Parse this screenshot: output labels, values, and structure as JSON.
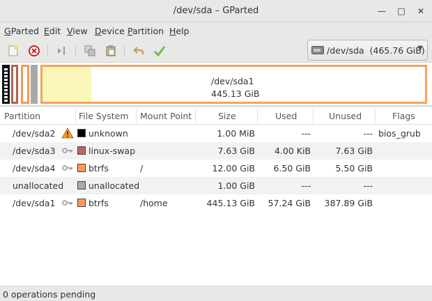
{
  "window": {
    "title": "/dev/sda – GParted"
  },
  "menu": [
    {
      "pre": "",
      "key": "G",
      "post": "Parted"
    },
    {
      "pre": "",
      "key": "E",
      "post": "dit"
    },
    {
      "pre": "",
      "key": "V",
      "post": "iew"
    },
    {
      "pre": "",
      "key": "D",
      "post": "evice"
    },
    {
      "pre": "",
      "key": "P",
      "post": "artition"
    },
    {
      "pre": "",
      "key": "H",
      "post": "elp"
    }
  ],
  "device": {
    "name": "/dev/sda",
    "size": "(465.76 GiB)"
  },
  "diskmap": {
    "main_name": "/dev/sda1",
    "main_size": "445.13 GiB"
  },
  "columns": [
    "Partition",
    "File System",
    "Mount Point",
    "Size",
    "Used",
    "Unused",
    "Flags"
  ],
  "rows": [
    {
      "partition": "/dev/sda2",
      "icon": "warning-icon",
      "fs": "unknown",
      "fs_color": "#000000",
      "mount": "",
      "size": "1.00 MiB",
      "used": "---",
      "unused": "---",
      "flags": "bios_grub"
    },
    {
      "partition": "/dev/sda3",
      "icon": "key-icon",
      "fs": "linux-swap",
      "fs_color": "#c1665a",
      "mount": "",
      "size": "7.63 GiB",
      "used": "4.00 KiB",
      "unused": "7.63 GiB",
      "flags": ""
    },
    {
      "partition": "/dev/sda4",
      "icon": "key-icon",
      "fs": "btrfs",
      "fs_color": "#ff9955",
      "mount": "/",
      "size": "12.00 GiB",
      "used": "6.50 GiB",
      "unused": "5.50 GiB",
      "flags": ""
    },
    {
      "partition": "unallocated",
      "icon": "",
      "fs": "unallocated",
      "fs_color": "#a9a9a9",
      "mount": "",
      "size": "1.00 GiB",
      "used": "---",
      "unused": "---",
      "flags": ""
    },
    {
      "partition": "/dev/sda1",
      "icon": "key-icon",
      "fs": "btrfs",
      "fs_color": "#ff9955",
      "mount": "/home",
      "size": "445.13 GiB",
      "used": "57.24 GiB",
      "unused": "387.89 GiB",
      "flags": ""
    }
  ],
  "status": "0 operations pending"
}
